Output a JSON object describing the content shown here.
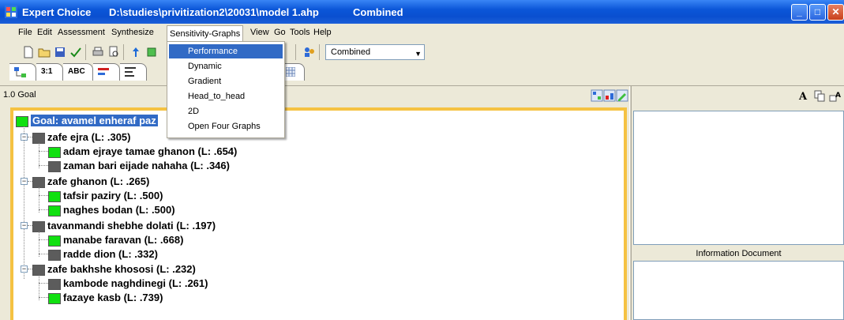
{
  "window": {
    "app_name": "Expert Choice",
    "file_path": "D:\\studies\\privitization2\\20031\\model 1.ahp",
    "mode": "Combined",
    "controls": {
      "minimize": "_",
      "maximize": "□",
      "close": "✕"
    }
  },
  "menu": {
    "items": [
      "File",
      "Edit",
      "Assessment",
      "Synthesize",
      "Sensitivity-Graphs",
      "View",
      "Go",
      "Tools",
      "Help"
    ]
  },
  "sensitivity_menu": {
    "items": [
      "Performance",
      "Dynamic",
      "Gradient",
      "Head_to_head",
      "2D",
      "Open Four Graphs"
    ],
    "highlighted": "Performance"
  },
  "toolbar": {
    "combined_select": "Combined"
  },
  "tabs": [
    "3:1",
    "ABC"
  ],
  "goal_header": "1.0 Goal",
  "tree": {
    "goal": "Goal: avamel enheraf paz",
    "criteria": [
      {
        "label": "zafe ejra (L: .305)",
        "children": [
          {
            "label": "adam ejraye tamae ghanon (L: .654)",
            "color": "green"
          },
          {
            "label": "zaman bari eijade nahaha (L: .346)",
            "color": "grey"
          }
        ]
      },
      {
        "label": "zafe ghanon (L: .265)",
        "children": [
          {
            "label": "tafsir paziry (L: .500)",
            "color": "green"
          },
          {
            "label": "naghes bodan (L: .500)",
            "color": "green"
          }
        ]
      },
      {
        "label": "tavanmandi shebhe dolati (L: .197)",
        "children": [
          {
            "label": "manabe faravan (L: .668)",
            "color": "green"
          },
          {
            "label": "radde dion (L: .332)",
            "color": "grey"
          }
        ]
      },
      {
        "label": "zafe bakhshe khososi (L: .232)",
        "children": [
          {
            "label": "kambode naghdinegi (L: .261)",
            "color": "grey"
          },
          {
            "label": "fazaye kasb (L: .739)",
            "color": "green"
          }
        ]
      }
    ]
  },
  "right_panel": {
    "info_label": "Information Document"
  },
  "colors": {
    "titlebar": "#0a4fd0",
    "selection": "#316ac5",
    "tree_frame": "#f5c242",
    "node_green": "#10e010",
    "node_grey": "#5c5c5c"
  }
}
